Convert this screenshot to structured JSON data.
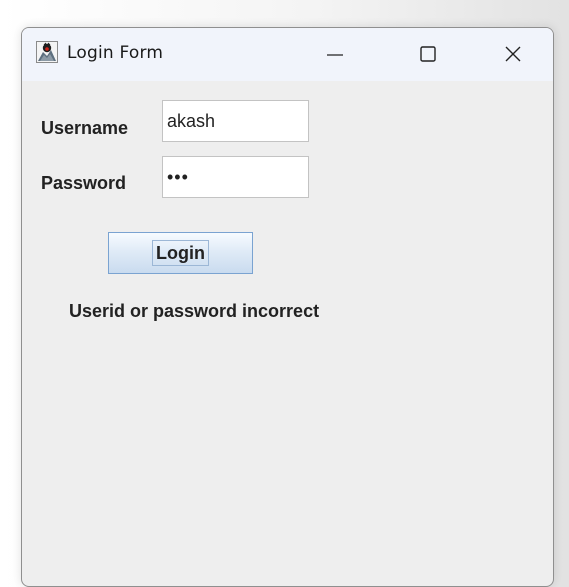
{
  "window": {
    "title": "Login Form",
    "icon": "java-duke-icon",
    "controls": {
      "minimize_icon": "minimize-icon",
      "maximize_icon": "maximize-icon",
      "close_icon": "close-icon"
    }
  },
  "form": {
    "username_label": "Username",
    "username_value": "akash",
    "password_label": "Password",
    "password_value": "abc",
    "login_label": "Login",
    "message": "Userid or password incorrect"
  },
  "colors": {
    "window_bg": "#eeeeee",
    "titlebar_bg": "#f1f4fb",
    "button_border": "#7aa3d1"
  }
}
